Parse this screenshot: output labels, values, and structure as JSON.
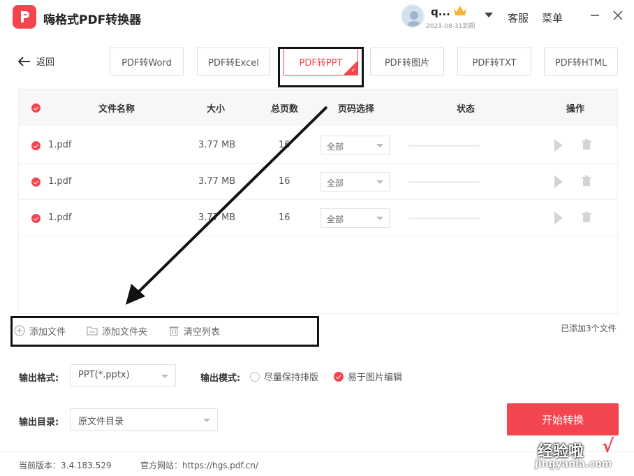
{
  "app": {
    "title": "嗨格式PDF转换器"
  },
  "user": {
    "name": "q...",
    "expiry": "2023-08-31到期"
  },
  "header": {
    "service_label": "客服",
    "menu_label": "菜单"
  },
  "back_label": "返回",
  "tabs": [
    {
      "label": "PDF转Word"
    },
    {
      "label": "PDF转Excel"
    },
    {
      "label": "PDF转PPT",
      "active": true
    },
    {
      "label": "PDF转图片"
    },
    {
      "label": "PDF转TXT"
    },
    {
      "label": "PDF转HTML"
    }
  ],
  "table": {
    "headers": {
      "name": "文件名称",
      "size": "大小",
      "pages": "总页数",
      "page_select": "页码选择",
      "status": "状态",
      "actions": "操作"
    },
    "rows": [
      {
        "name": "1.pdf",
        "size": "3.77 MB",
        "pages": "16",
        "page_select": "全部"
      },
      {
        "name": "1.pdf",
        "size": "3.77 MB",
        "pages": "16",
        "page_select": "全部"
      },
      {
        "name": "1.pdf",
        "size": "3.77 MB",
        "pages": "16",
        "page_select": "全部"
      }
    ]
  },
  "toolbar": {
    "add_file": "添加文件",
    "add_folder": "添加文件夹",
    "clear_list": "清空列表"
  },
  "added_count": "已添加3个文件",
  "settings": {
    "format_label": "输出格式:",
    "format_value": "PPT(*.pptx)",
    "mode_label": "输出模式:",
    "mode_options": [
      {
        "label": "尽量保持排版",
        "selected": false
      },
      {
        "label": "易于图片编辑",
        "selected": true
      }
    ],
    "dir_label": "输出目录:",
    "dir_value": "原文件目录"
  },
  "start_button": "开始转换",
  "footer": {
    "version": "当前版本：3.4.183.529",
    "website": "官方网站：https://hgs.pdf.cn/"
  },
  "watermark": {
    "text": "经验啦",
    "sub": "jingyanla.com",
    "check": "√"
  },
  "colors": {
    "accent": "#f2454f",
    "annotation": "#111111"
  }
}
